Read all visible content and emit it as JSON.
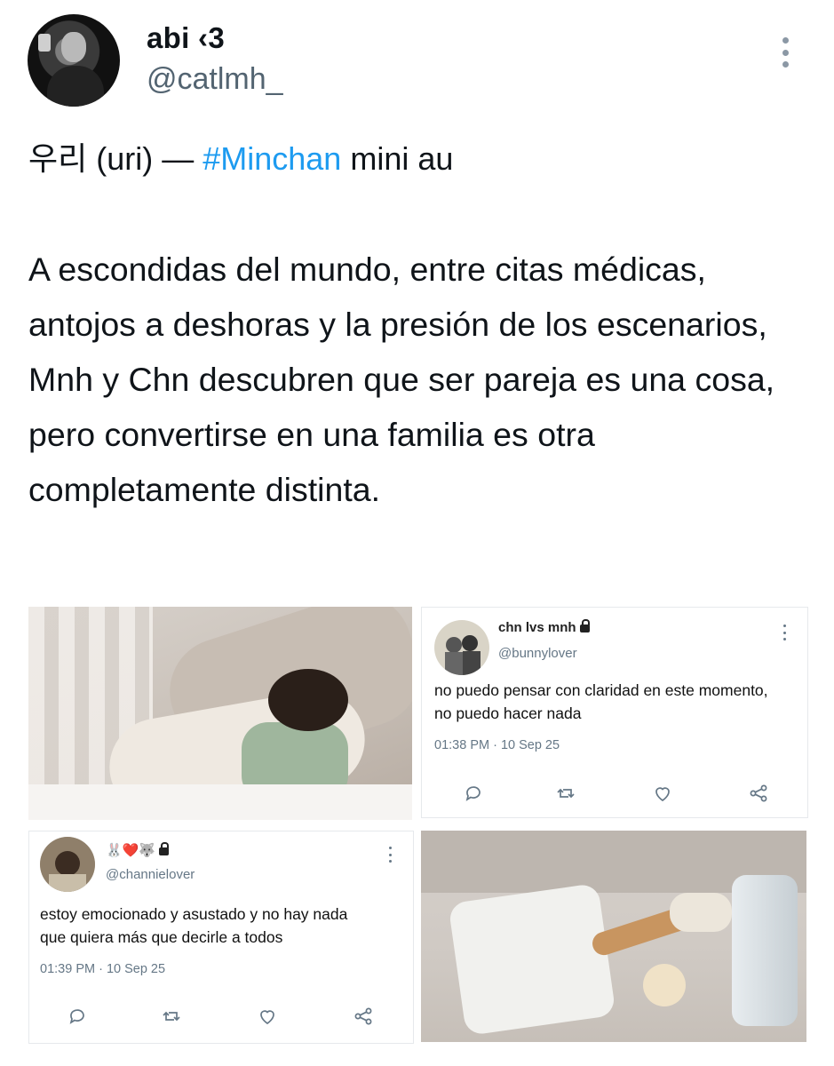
{
  "tweet": {
    "display_name": "abi ‹3",
    "handle": "@catlmh_",
    "title_prefix": "우리 (uri) — ",
    "hashtag": "#Minchan",
    "title_suffix": " mini au",
    "body": "A escondidas del mundo, entre citas médicas, antojos a deshoras y la presión de los escenarios, Mnh y Chn descubren que ser pareja es una cosa, pero convertirse en una familia es otra completamente distinta."
  },
  "media": {
    "card1": {
      "name": "chn lvs mnh",
      "handle": "@bunnylover",
      "text": "no puedo pensar con claridad en este momento, no puedo hacer nada",
      "meta": "01:38 PM · 10 Sep 25"
    },
    "card2": {
      "name": "🐰❤️🐺",
      "handle": "@channielover",
      "text": "estoy emocionado y asustado y no hay nada que quiera más que decirle a todos",
      "meta": "01:39 PM · 10 Sep 25"
    }
  },
  "colors": {
    "hashtag": "#1d9bf0",
    "text": "#0f1419",
    "secondary": "#536471"
  },
  "icons": [
    "more-vertical-icon",
    "lock-icon",
    "reply-icon",
    "retweet-icon",
    "like-icon",
    "share-icon"
  ]
}
